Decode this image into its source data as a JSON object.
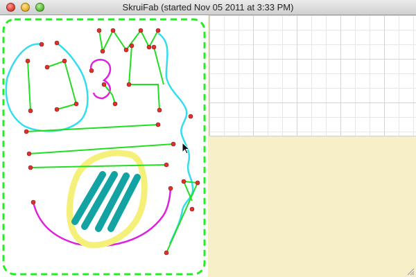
{
  "window": {
    "title": "SkruiFab (started Nov 05 2011 at 3:33 PM)"
  },
  "colors": {
    "border_dash": "#22ee22",
    "stroke_green": "#22dd22",
    "stroke_cyan": "#33ddee",
    "stroke_magenta": "#dd22dd",
    "highlight_yellow": "#f5f07a",
    "hatch_teal": "#13a3a3",
    "dot_red": "#e0302a",
    "beige_panel": "#f7efc8"
  },
  "icons": {
    "close": "close-icon",
    "minimize": "minimize-icon",
    "zoom": "zoom-icon",
    "cursor": "arrow-cursor-icon",
    "resize": "resize-grip-icon"
  }
}
